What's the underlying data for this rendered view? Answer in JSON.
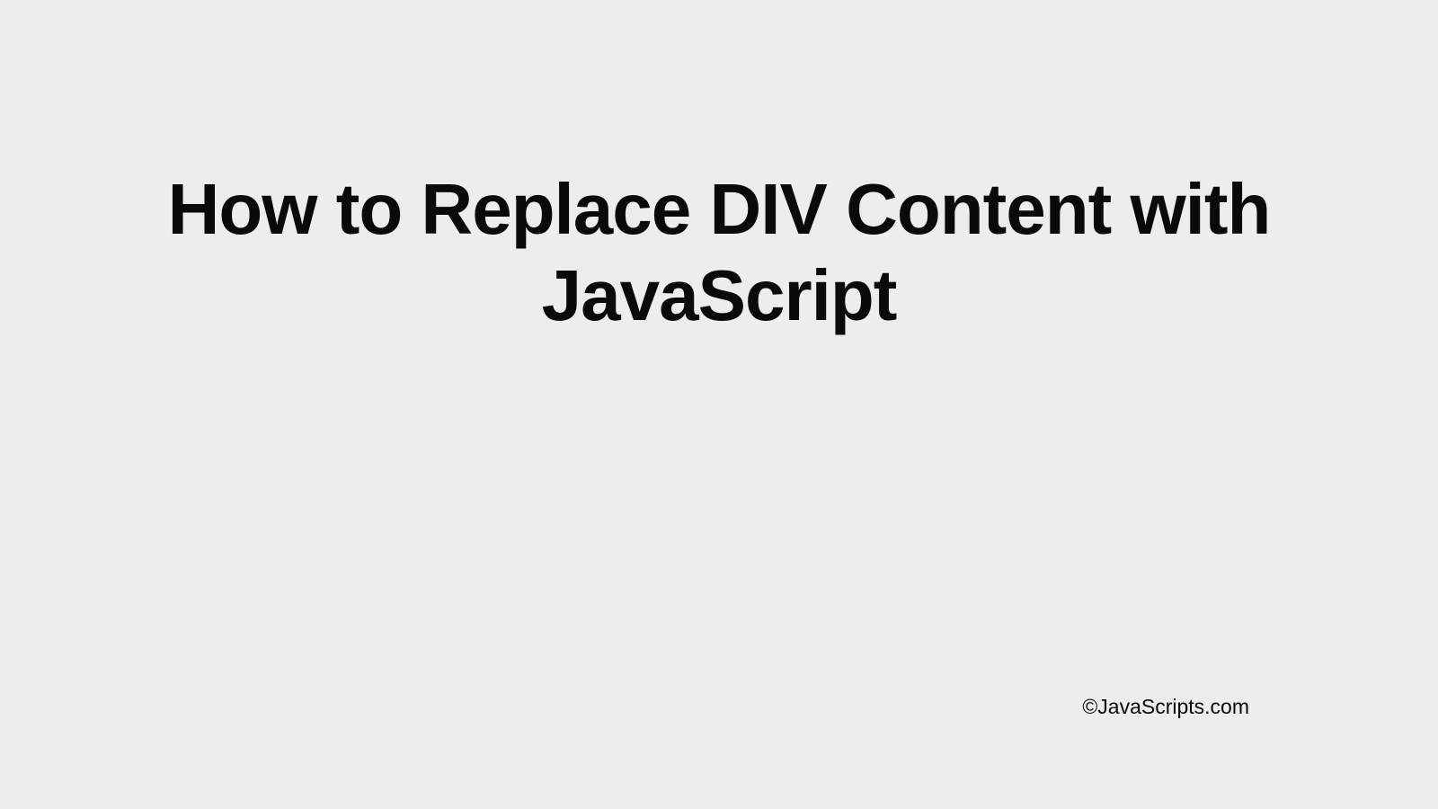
{
  "slide": {
    "title": "How to Replace DIV Content with JavaScript",
    "footer": "©JavaScripts.com"
  }
}
